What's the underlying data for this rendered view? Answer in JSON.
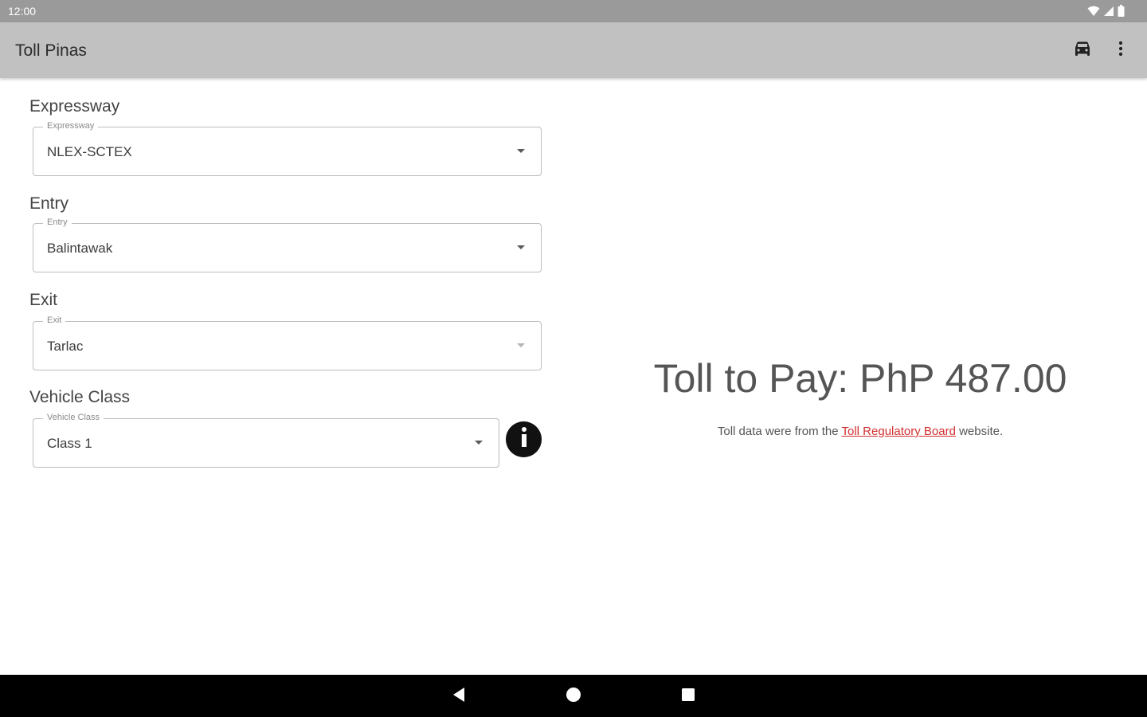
{
  "status_bar": {
    "time": "12:00",
    "icons": [
      "wifi-icon",
      "signal-icon",
      "battery-icon"
    ]
  },
  "app_bar": {
    "title": "Toll Pinas",
    "actions": [
      "car-icon",
      "more-vert-icon"
    ]
  },
  "form": {
    "expressway": {
      "section_label": "Expressway",
      "field_label": "Expressway",
      "value": "NLEX-SCTEX"
    },
    "entry": {
      "section_label": "Entry",
      "field_label": "Entry",
      "value": "Balintawak"
    },
    "exit": {
      "section_label": "Exit",
      "field_label": "Exit",
      "value": "Tarlac"
    },
    "vehicle_class": {
      "section_label": "Vehicle Class",
      "field_label": "Vehicle Class",
      "value": "Class 1"
    },
    "info_icon": "info-icon"
  },
  "result": {
    "toll_text": "Toll to Pay: PhP 487.00",
    "source_prefix": "Toll data were from the ",
    "source_link": "Toll Regulatory Board",
    "source_suffix": " website."
  },
  "nav_bar": {
    "buttons": [
      "back-icon",
      "home-icon",
      "recents-icon"
    ]
  },
  "colors": {
    "status_bar": "#9a9a9a",
    "app_bar": "#c1c1c1",
    "link": "#d32f2f",
    "nav_bar": "#000000"
  }
}
